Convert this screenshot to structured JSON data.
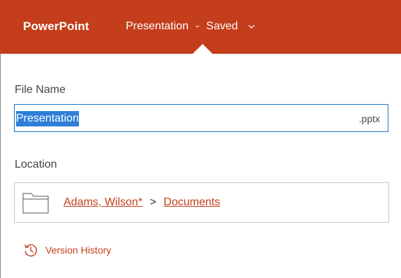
{
  "header": {
    "app_name": "PowerPoint",
    "doc_title": "Presentation",
    "separator": "-",
    "status": "Saved",
    "brand_color": "#c43e1c"
  },
  "file": {
    "label": "File Name",
    "value": "Presentation",
    "extension": ".pptx"
  },
  "location": {
    "label": "Location",
    "owner": "Adams, Wilson*",
    "separator": ">",
    "folder": "Documents",
    "icon": "folder-icon"
  },
  "version": {
    "label": "Version History",
    "icon": "history-icon"
  }
}
